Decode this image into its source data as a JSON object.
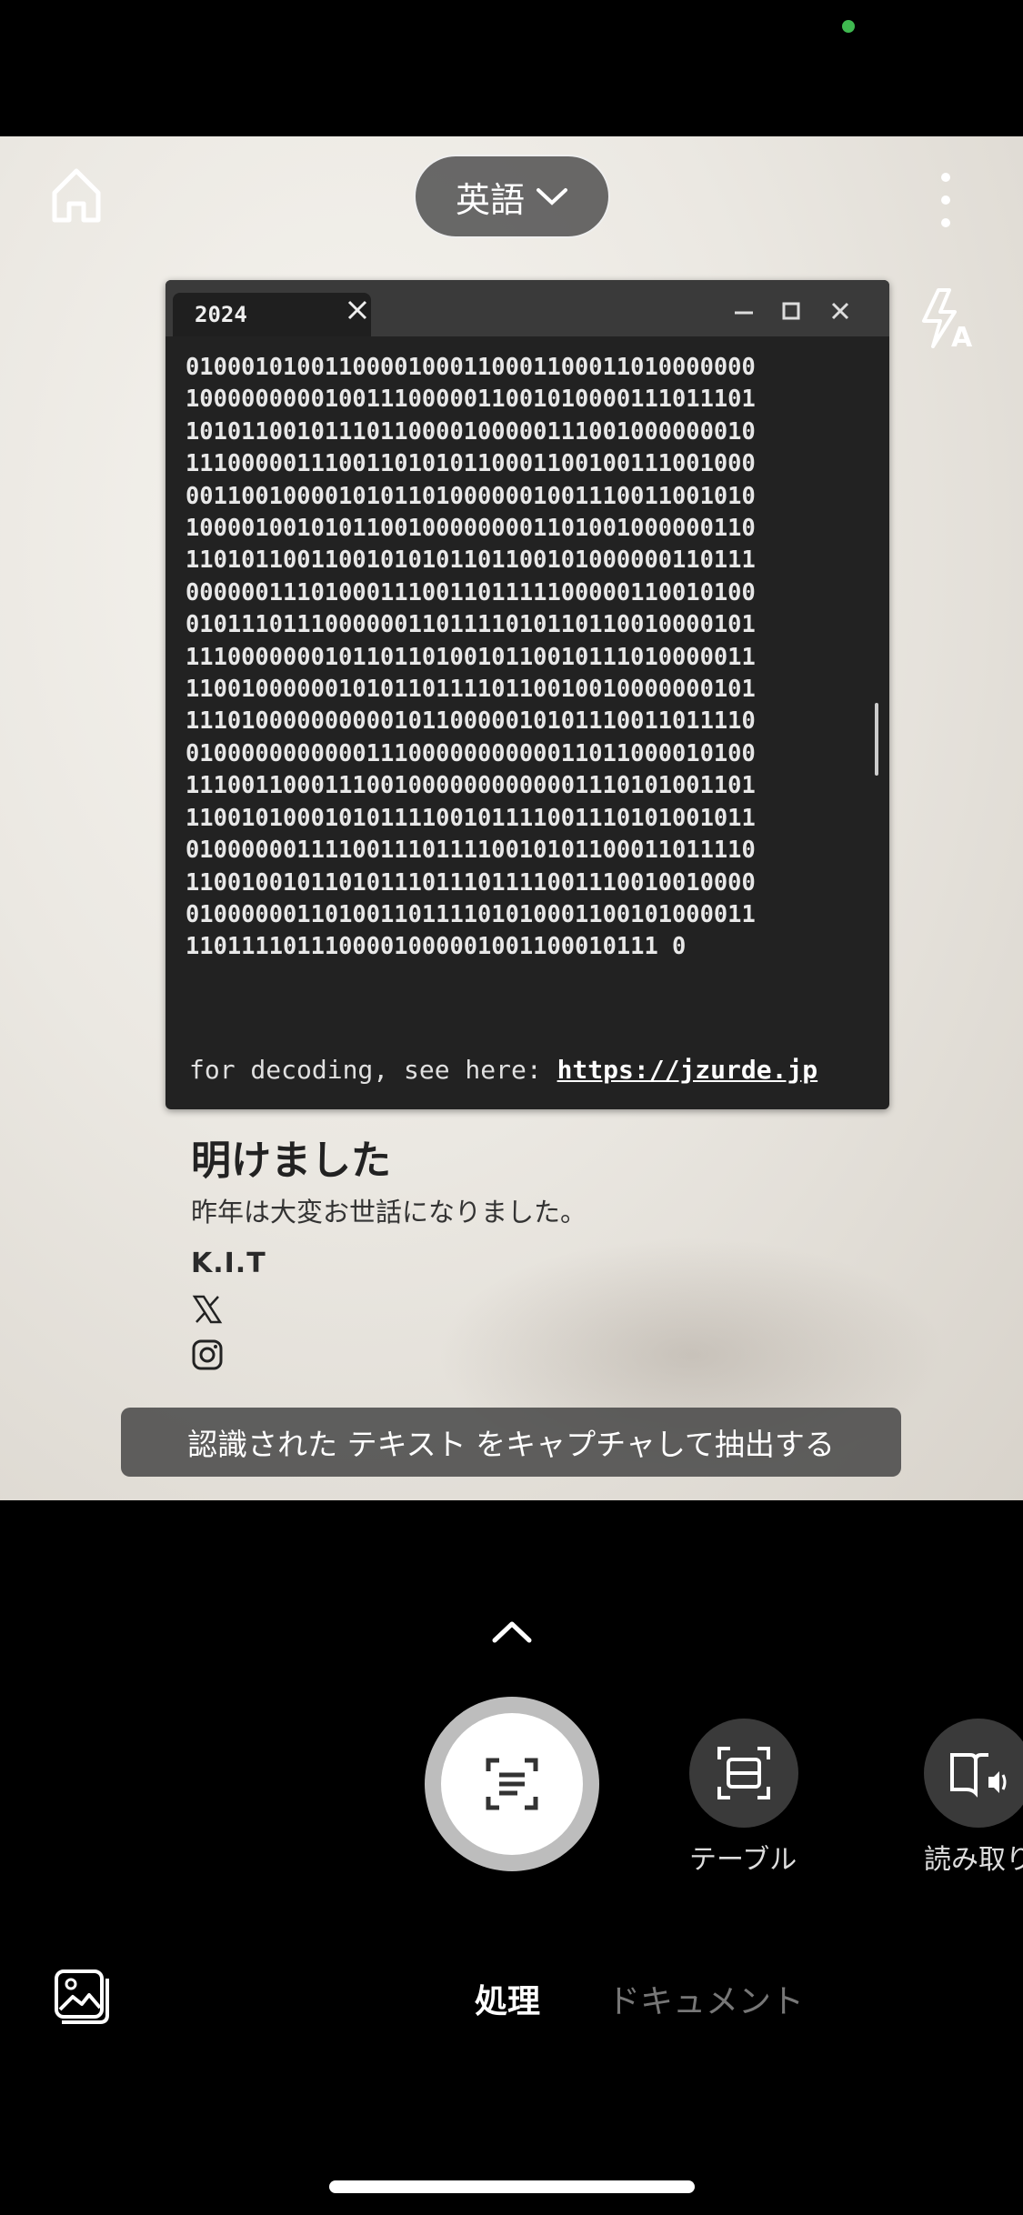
{
  "camera": {
    "language_label": "英語",
    "banner_text": "認識された テキスト をキャプチャして抽出する"
  },
  "terminal": {
    "tab_label": "2024",
    "binary_lines": [
      "01000101001100001000110001100011010000000",
      "10000000001001110000011001010000111011101",
      "10101100101110110000100000111001000000010",
      "11100000111001101010110001100100111001000",
      "00110010000101011010000001001110011001010",
      "10000100101011001000000001101001000000110",
      "11010110011001010101101100101000000110111",
      "00000011101000111001101111100000110010100",
      "01011101110000001101111010110110010000101",
      "11100000001011011010010110010111010000011",
      "11001000000101011011110110010010000000101",
      "11101000000000010110000010101110011011110",
      "01000000000001110000000000011011000010100",
      "11100110001110010000000000001110101001101",
      "11001010001010111100101111001110101001011",
      "01000000111100111011110010101100011011110",
      "11001001011010111011101111001110010010000",
      "01000000110100110111101010001100101000011",
      "1101111011100001000001001100010111 0"
    ],
    "footer_prefix": "for decoding, see here: ",
    "footer_link": "https://jzurde.jp"
  },
  "card": {
    "title": "明けました",
    "subtitle": "昨年は大変お世話になりました。",
    "author": "K.I.T"
  },
  "icons": [
    "home-icon",
    "chevron-down-icon",
    "more-vertical-icon",
    "flash-auto-icon",
    "close-icon",
    "minimize-icon",
    "maximize-icon",
    "x-logo-icon",
    "instagram-icon",
    "chevron-up-icon",
    "text-scan-icon",
    "table-scan-icon",
    "read-aloud-icon",
    "gallery-icon"
  ],
  "modes": {
    "table_label": "テーブル",
    "read_label": "読み取り"
  },
  "tabs": {
    "process": "処理",
    "document": "ドキュメント"
  }
}
